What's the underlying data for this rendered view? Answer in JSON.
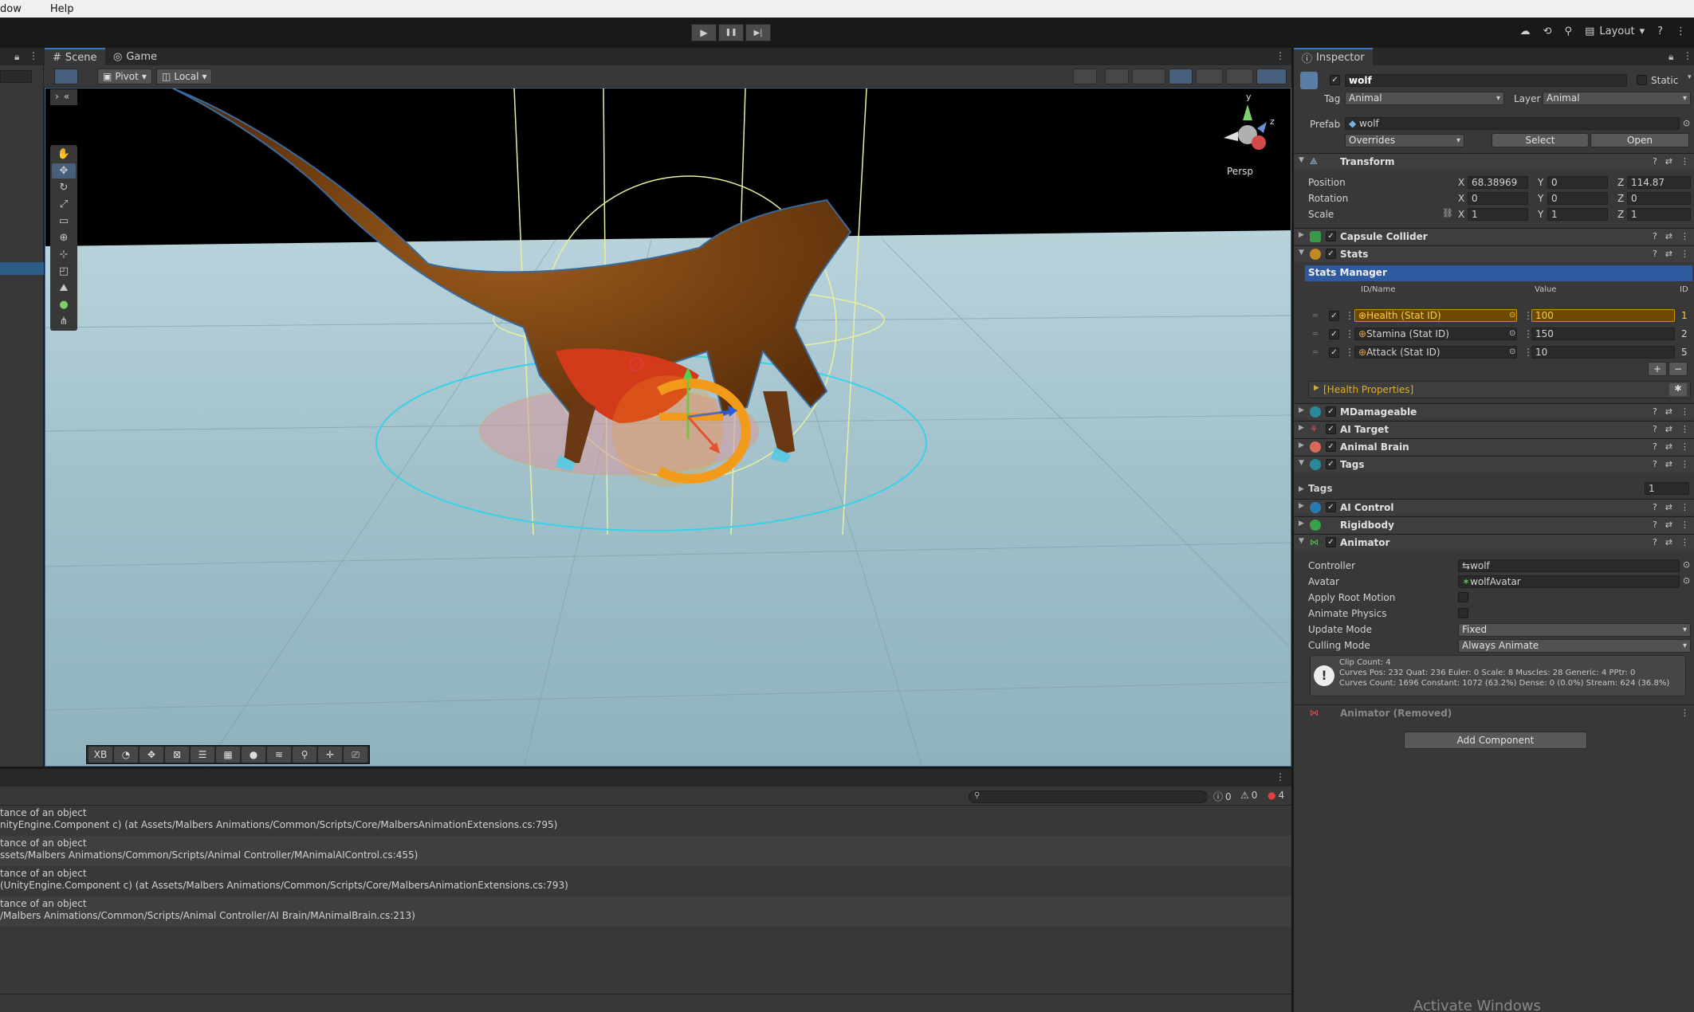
{
  "menu": [
    "dow",
    "Help"
  ],
  "toolbar": {
    "play": "▶",
    "pause": "❚❚",
    "step": "▶|",
    "layout_label": "Layout"
  },
  "scene": {
    "tab_scene": "Scene",
    "tab_game": "Game",
    "pivot": "Pivot",
    "local": "Local",
    "persp_label": "Persp",
    "overlay_xb": "XB"
  },
  "console": {
    "count_info": "0",
    "count_warn": "0",
    "count_error": "4",
    "logs": [
      {
        "line1": "tance of an object",
        "line2": "nityEngine.Component c) (at Assets/Malbers Animations/Common/Scripts/Core/MalbersAnimationExtensions.cs:795)"
      },
      {
        "line1": "tance of an object",
        "line2": "ssets/Malbers Animations/Common/Scripts/Animal Controller/MAnimalAIControl.cs:455)"
      },
      {
        "line1": "tance of an object",
        "line2": "(UnityEngine.Component c) (at Assets/Malbers Animations/Common/Scripts/Core/MalbersAnimationExtensions.cs:793)"
      },
      {
        "line1": "tance of an object",
        "line2": "/Malbers Animations/Common/Scripts/Animal Controller/AI Brain/MAnimalBrain.cs:213)"
      }
    ]
  },
  "inspector": {
    "tab": "Inspector",
    "object_name": "wolf",
    "static_label": "Static",
    "tag_label": "Tag",
    "tag_value": "Animal",
    "layer_label": "Layer",
    "layer_value": "Animal",
    "prefab_label": "Prefab",
    "prefab_value": "wolf",
    "overrides": "Overrides",
    "select": "Select",
    "open": "Open",
    "transform": {
      "title": "Transform",
      "position_label": "Position",
      "px": "68.38969",
      "py": "0",
      "pz": "114.87",
      "rotation_label": "Rotation",
      "rx": "0",
      "ry": "0",
      "rz": "0",
      "scale_label": "Scale",
      "sx": "1",
      "sy": "1",
      "sz": "1",
      "x": "X",
      "y": "Y",
      "z": "Z"
    },
    "capsule_collider": "Capsule Collider",
    "stats": {
      "title": "Stats",
      "manager": "Stats Manager",
      "col_id": "ID/Name",
      "col_value": "Value",
      "col_idnum": "ID",
      "rows": [
        {
          "name": "Health (Stat ID)",
          "value": "100",
          "id": "1"
        },
        {
          "name": "Stamina (Stat ID)",
          "value": "150",
          "id": "2"
        },
        {
          "name": "Attack (Stat ID)",
          "value": "10",
          "id": "5"
        }
      ],
      "plus": "+",
      "minus": "−",
      "health_props": "[Health Properties]"
    },
    "mdamageable": "MDamageable",
    "ai_target": "AI Target",
    "animal_brain": "Animal Brain",
    "tags": {
      "title": "Tags",
      "label": "Tags",
      "count": "1"
    },
    "ai_control": "AI Control",
    "rigidbody": "Rigidbody",
    "animator": {
      "title": "Animator",
      "controller_label": "Controller",
      "controller_value": "wolf",
      "avatar_label": "Avatar",
      "avatar_value": "wolfAvatar",
      "root_motion_label": "Apply Root Motion",
      "animate_physics_label": "Animate Physics",
      "update_mode_label": "Update Mode",
      "update_mode_value": "Fixed",
      "culling_mode_label": "Culling Mode",
      "culling_mode_value": "Always Animate",
      "info1": "Clip Count: 4",
      "info2": "Curves Pos: 232 Quat: 236 Euler: 0 Scale: 8 Muscles: 28 Generic: 4 PPtr: 0",
      "info3": "Curves Count: 1696 Constant: 1072 (63.2%) Dense: 0 (0.0%) Stream: 624 (36.8%)"
    },
    "animator_removed": "Animator (Removed)",
    "add_component": "Add Component"
  },
  "watermark": "Activate Windows",
  "colors": {
    "accent": "#3a79bb",
    "selection": "#2e5aa0",
    "highlight": "#d09000",
    "error": "#e04040"
  }
}
